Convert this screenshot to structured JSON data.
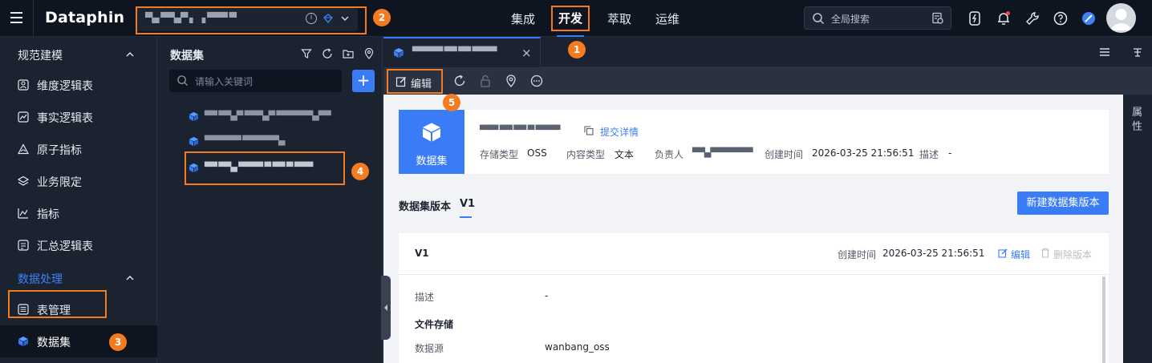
{
  "app": {
    "logo": "Dataphin"
  },
  "topbar": {
    "project_name": "▀▄ ▀▀▄▀  ▖  ▗ ▀▀▀ ▀",
    "nav": [
      "集成",
      "开发",
      "萃取",
      "运维"
    ],
    "active_nav": "开发",
    "search_placeholder": "全局搜索"
  },
  "sidebar": {
    "group1": "规范建模",
    "items1": [
      "维度逻辑表",
      "事实逻辑表",
      "原子指标",
      "业务限定",
      "指标",
      "汇总逻辑表"
    ],
    "group2": "数据处理",
    "items2": [
      "表管理",
      "数据集"
    ]
  },
  "dataset_panel": {
    "title": "数据集",
    "search_placeholder": "请输入关键词",
    "add_label": "+",
    "items": [
      "▀▀ ▀▀▄▀ ▀▀▀▄▀ ▀▀▀▀▀▀▄▀▀",
      "▀▀▀▀▀▀ ▀▀▀▀▀▀▄",
      "▀▀ ▀▀▄ ▀▀▀▀ ▀ ▀▀ ▀ ▀▀▀"
    ]
  },
  "tab": {
    "name": "▀▀▀▀▀ ▀▀  ▀▀ ▀▀▀▀",
    "close": "×"
  },
  "toolbar": {
    "edit_label": "编辑"
  },
  "right_strip": {
    "label": "属性"
  },
  "card": {
    "icon_label": "数据集",
    "name_blur": "▀▀▀ ▀▀ ▀▀ ▀ ▀▀▀▀",
    "submit_link": "提交详情",
    "meta": [
      {
        "k": "存储类型",
        "v": "OSS"
      },
      {
        "k": "内容类型",
        "v": "文本"
      },
      {
        "k": "负责人",
        "v": "▀▀▄▀▀▀▀▀▀▀"
      },
      {
        "k": "创建时间",
        "v": "2026-03-25 21:56:51"
      },
      {
        "k": "描述",
        "v": "-"
      }
    ]
  },
  "versions": {
    "label": "数据集版本",
    "current": "V1",
    "new_button": "新建数据集版本"
  },
  "version_card": {
    "title": "V1",
    "created_label": "创建时间",
    "created_value": "2026-03-25 21:56:51",
    "edit": "编辑",
    "delete": "删除版本",
    "rows": [
      {
        "k": "描述",
        "v": "-"
      },
      {
        "section": "文件存储"
      },
      {
        "k": "数据源",
        "v": "wanbang_oss"
      }
    ]
  },
  "callouts": [
    "1",
    "2",
    "3",
    "4",
    "5"
  ],
  "colors": {
    "accent": "#3a7cf5",
    "highlight": "#f47b20",
    "bg": "#1b2230"
  }
}
